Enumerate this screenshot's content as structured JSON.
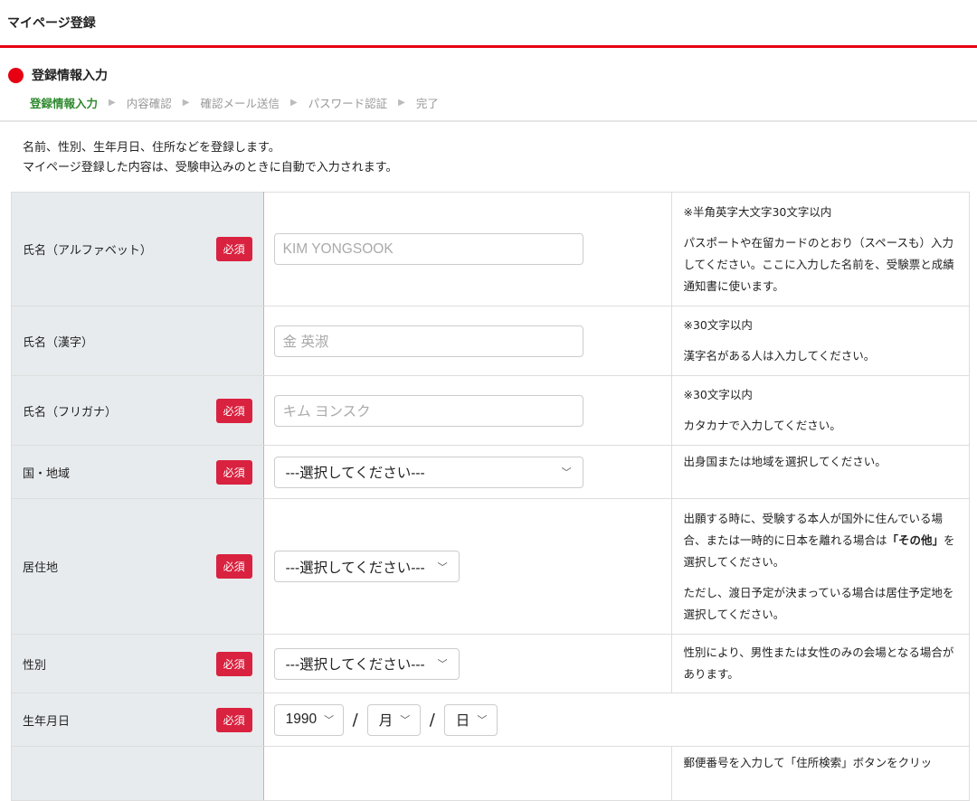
{
  "header": {
    "title": "マイページ登録"
  },
  "section": {
    "title": "登録情報入力"
  },
  "steps": [
    "登録情報入力",
    "内容確認",
    "確認メール送信",
    "パスワード認証",
    "完了"
  ],
  "intro": [
    "名前、性別、生年月日、住所などを登録します。",
    "マイページ登録した内容は、受験申込みのときに自動で入力されます。"
  ],
  "required_label": "必須",
  "rows": {
    "name_alpha": {
      "label": "氏名（アルファベット）",
      "placeholder": "KIM YONGSOOK",
      "note1": "※半角英字大文字30文字以内",
      "note2": "パスポートや在留カードのとおり（スペースも）入力してください。ここに入力した名前を、受験票と成績通知書に使います。"
    },
    "name_kanji": {
      "label": "氏名（漢字）",
      "placeholder": "金 英淑",
      "note1": "※30文字以内",
      "note2": "漢字名がある人は入力してください。"
    },
    "name_kana": {
      "label": "氏名（フリガナ）",
      "placeholder": "キム ヨンスク",
      "note1": "※30文字以内",
      "note2": "カタカナで入力してください。"
    },
    "country": {
      "label": "国・地域",
      "value": "---選択してください---",
      "note1": "出身国または地域を選択してください。"
    },
    "residence": {
      "label": "居住地",
      "value": "---選択してください---",
      "note_a": "出願する時に、受験する本人が国外に住んでいる場合、または一時的に日本を離れる場合は",
      "note_bold": "「その他」",
      "note_b": "を選択してください。",
      "note2": "ただし、渡日予定が決まっている場合は居住予定地を選択してください。"
    },
    "gender": {
      "label": "性別",
      "value": "---選択してください---",
      "note1": "性別により、男性または女性のみの会場となる場合があります。"
    },
    "birth": {
      "label": "生年月日",
      "year": "1990",
      "month": "月",
      "day": "日",
      "sep": "/"
    },
    "address": {
      "note1": "郵便番号を入力して「住所検索」ボタンをクリッ"
    }
  }
}
